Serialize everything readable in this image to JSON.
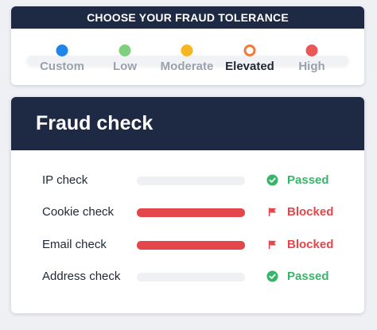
{
  "tolerance": {
    "title": "CHOOSE YOUR FRAUD TOLERANCE",
    "options": [
      {
        "label": "Custom",
        "color": "#1f86e8",
        "selected": false
      },
      {
        "label": "Low",
        "color": "#7ed07e",
        "selected": false
      },
      {
        "label": "Moderate",
        "color": "#f6b622",
        "selected": false
      },
      {
        "label": "Elevated",
        "color": "#f07a3a",
        "selected": true
      },
      {
        "label": "High",
        "color": "#ea5757",
        "selected": false
      }
    ]
  },
  "fraud_check": {
    "title": "Fraud check",
    "checks": [
      {
        "label": "IP check",
        "status": "Passed",
        "result": "passed",
        "icon": "check-circle-icon",
        "bar_color": "#eef0f4"
      },
      {
        "label": "Cookie check",
        "status": "Blocked",
        "result": "blocked",
        "icon": "flag-icon",
        "bar_color": "#e4474b"
      },
      {
        "label": "Email check",
        "status": "Blocked",
        "result": "blocked",
        "icon": "flag-icon",
        "bar_color": "#e4474b"
      },
      {
        "label": "Address check",
        "status": "Passed",
        "result": "passed",
        "icon": "check-circle-icon",
        "bar_color": "#eef0f4"
      }
    ]
  }
}
